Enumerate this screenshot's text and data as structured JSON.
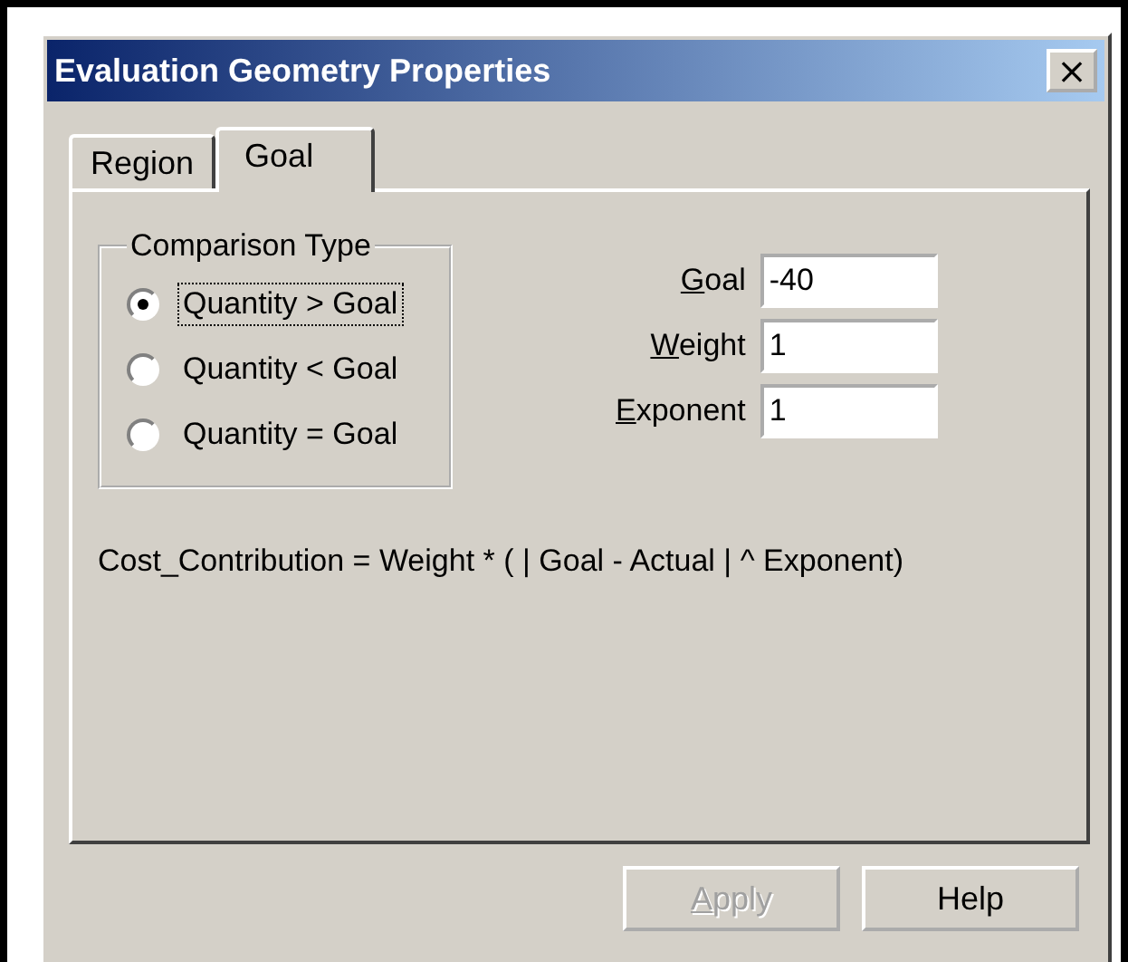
{
  "window": {
    "title": "Evaluation Geometry Properties",
    "close": "×"
  },
  "tabs": [
    {
      "label": "Region",
      "selected": false
    },
    {
      "label": "Goal",
      "selected": true
    }
  ],
  "comparison_type": {
    "title": "Comparison Type",
    "options": [
      {
        "label": "Quantity > Goal",
        "selected": true
      },
      {
        "label": "Quantity < Goal",
        "selected": false
      },
      {
        "label": "Quantity = Goal",
        "selected": false
      }
    ]
  },
  "fields": [
    {
      "label": "Goal",
      "value": "-40",
      "first_letter_underlined": true
    },
    {
      "label": "Weight",
      "value": "1",
      "first_letter_underlined": true
    },
    {
      "label": "Exponent",
      "value": "1",
      "first_letter_underlined": true
    }
  ],
  "formula": "Cost_Contribution = Weight * ( | Goal - Actual | ^ Exponent)",
  "buttons": [
    {
      "label": "Apply",
      "disabled": true,
      "first_letter_underlined": true
    },
    {
      "label": "Help",
      "disabled": false
    }
  ]
}
